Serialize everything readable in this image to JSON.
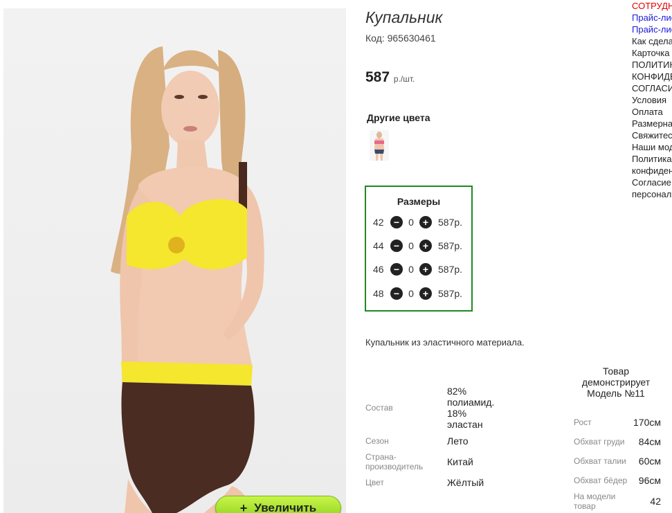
{
  "product": {
    "title": "Купальник",
    "code": "Код: 965630461",
    "price": "587",
    "price_unit": "р./шт.",
    "other_colors_label": "Другие цвета",
    "zoom_button": "Увеличить",
    "zoom_icon": "+",
    "description": "Купальник из эластичного материала."
  },
  "sizes": {
    "title": "Размеры",
    "rows": [
      {
        "size": "42",
        "qty": "0",
        "price": "587р."
      },
      {
        "size": "44",
        "qty": "0",
        "price": "587р."
      },
      {
        "size": "46",
        "qty": "0",
        "price": "587р."
      },
      {
        "size": "48",
        "qty": "0",
        "price": "587р."
      }
    ]
  },
  "specs": [
    {
      "label": "Состав",
      "value": "82%\nполиамид.\n18%\nэластан"
    },
    {
      "label": "Сезон",
      "value": "Лето"
    },
    {
      "label": "Страна-\nпроизводитель",
      "value": "Китай"
    },
    {
      "label": "Цвет",
      "value": "Жёлтый"
    }
  ],
  "model": {
    "heading": "Товар\nдемонстрирует\nМодель №11",
    "rows": [
      {
        "label": "Рост",
        "value": "170см"
      },
      {
        "label": "Обхват груди",
        "value": "84см"
      },
      {
        "label": "Обхват талии",
        "value": "60см"
      },
      {
        "label": "Обхват бёдер",
        "value": "96см"
      },
      {
        "label": "На модели\nтовар",
        "value": "42"
      }
    ]
  },
  "sidebar": [
    {
      "text": "СОТРУДНИЧЕСТВО",
      "color": "#e20000"
    },
    {
      "text": "Прайс-лист",
      "color": "#1a1ad6"
    },
    {
      "text": "Прайс-лист",
      "color": "#1a1ad6"
    },
    {
      "text": "Как сделать заказ",
      "color": "#222222"
    },
    {
      "text": "Карточка",
      "color": "#222222"
    },
    {
      "text": "ПОЛИТИКА",
      "color": "#222222"
    },
    {
      "text": "КОНФИДЕНЦИАЛЬНОСТИ",
      "color": "#222222"
    },
    {
      "text": "СОГЛАСИЕ",
      "color": "#222222"
    },
    {
      "text": "Условия",
      "color": "#222222"
    },
    {
      "text": "Оплата",
      "color": "#222222"
    },
    {
      "text": "Размерная",
      "color": "#222222"
    },
    {
      "text": "Свяжитесь",
      "color": "#222222"
    },
    {
      "text": "Наши модели",
      "color": "#222222"
    },
    {
      "text": "Политика",
      "color": "#222222"
    },
    {
      "text": "конфиденциальности",
      "color": "#222222"
    },
    {
      "text": "Согласие",
      "color": "#222222"
    },
    {
      "text": "персональных",
      "color": "#222222"
    }
  ],
  "colors": {
    "accent_green": "#1e8a1e",
    "zoom_button": "#9bd625",
    "link_red": "#e20000",
    "link_blue": "#1a1ad6"
  }
}
